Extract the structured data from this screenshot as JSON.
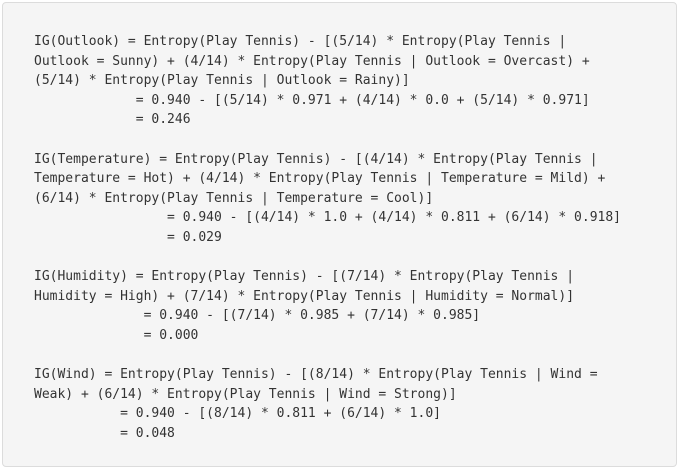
{
  "code_block": {
    "lines": [
      "IG(Outlook) = Entropy(Play Tennis) - [(5/14) * Entropy(Play Tennis |",
      "Outlook = Sunny) + (4/14) * Entropy(Play Tennis | Outlook = Overcast) +",
      "(5/14) * Entropy(Play Tennis | Outlook = Rainy)]",
      "             = 0.940 - [(5/14) * 0.971 + (4/14) * 0.0 + (5/14) * 0.971]",
      "             = 0.246",
      "",
      "IG(Temperature) = Entropy(Play Tennis) - [(4/14) * Entropy(Play Tennis |",
      "Temperature = Hot) + (4/14) * Entropy(Play Tennis | Temperature = Mild) +",
      "(6/14) * Entropy(Play Tennis | Temperature = Cool)]",
      "                 = 0.940 - [(4/14) * 1.0 + (4/14) * 0.811 + (6/14) * 0.918]",
      "                 = 0.029",
      "",
      "IG(Humidity) = Entropy(Play Tennis) - [(7/14) * Entropy(Play Tennis |",
      "Humidity = High) + (7/14) * Entropy(Play Tennis | Humidity = Normal)]",
      "              = 0.940 - [(7/14) * 0.985 + (7/14) * 0.985]",
      "              = 0.000",
      "",
      "IG(Wind) = Entropy(Play Tennis) - [(8/14) * Entropy(Play Tennis | Wind =",
      "Weak) + (6/14) * Entropy(Play Tennis | Wind = Strong)]",
      "           = 0.940 - [(8/14) * 0.811 + (6/14) * 1.0]",
      "           = 0.048"
    ]
  }
}
